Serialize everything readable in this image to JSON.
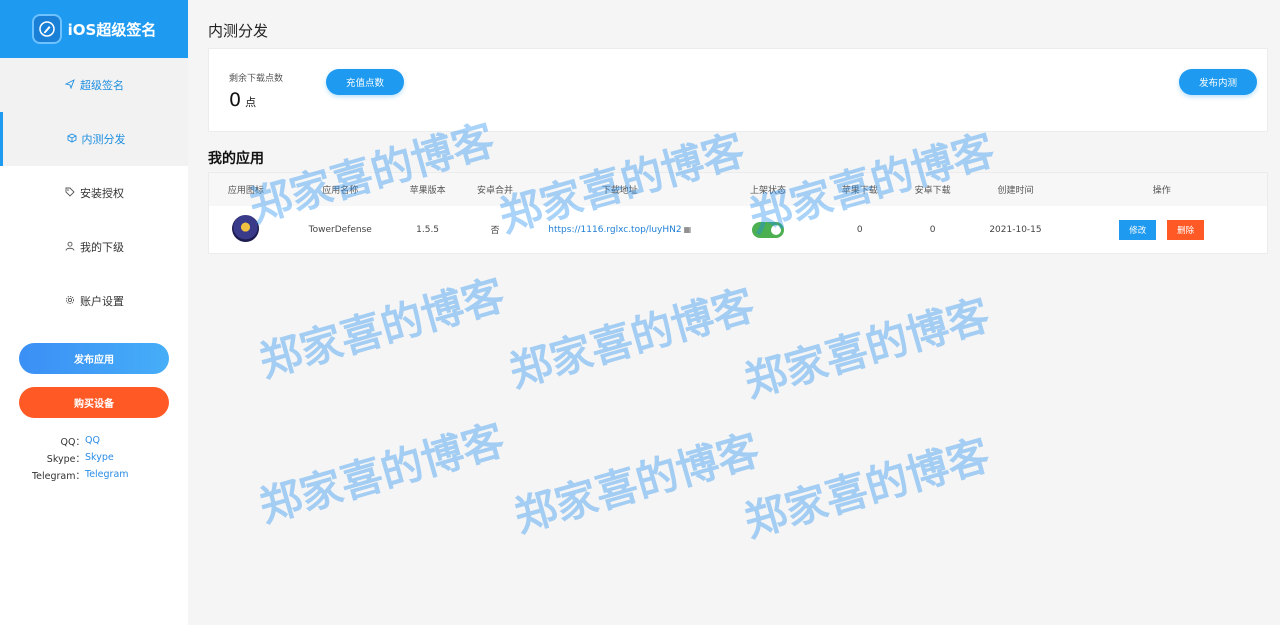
{
  "sidebar": {
    "logo_text": "iOS超级签名",
    "items": [
      {
        "label": "超级签名",
        "icon": "paper-plane-icon"
      },
      {
        "label": "内测分发",
        "icon": "cube-icon"
      },
      {
        "label": "安装授权",
        "icon": "tag-icon"
      },
      {
        "label": "我的下级",
        "icon": "user-icon"
      },
      {
        "label": "账户设置",
        "icon": "gear-icon"
      }
    ],
    "publish_label": "发布应用",
    "buy_label": "购买设备",
    "contacts": [
      {
        "key": "QQ：",
        "value": "QQ"
      },
      {
        "key": "Skype：",
        "value": "Skype"
      },
      {
        "key": "Telegram：",
        "value": "Telegram"
      }
    ]
  },
  "main": {
    "title": "内测分发",
    "balance_label": "剩余下载点数",
    "balance_value": "0",
    "balance_unit": "点",
    "recharge_label": "充值点数",
    "release_label": "发布内测",
    "section_title": "我的应用",
    "table": {
      "headers": [
        "应用图标",
        "应用名称",
        "苹果版本",
        "安卓合并",
        "下载地址",
        "上架状态",
        "苹果下载",
        "安卓下载",
        "创建时间",
        "操作"
      ],
      "rows": [
        {
          "name": "TowerDefense",
          "ios_version": "1.5.5",
          "android_merge": "否",
          "url": "https://1116.rglxc.top/luyHN2",
          "ios_downloads": "0",
          "android_downloads": "0",
          "created": "2021-10-15",
          "edit_label": "修改",
          "delete_label": "删除"
        }
      ]
    }
  },
  "watermark": "郑家喜的博客",
  "colors": {
    "accent": "#1e9af0",
    "danger": "#ff5a26",
    "toggle_on": "#4caf50"
  }
}
